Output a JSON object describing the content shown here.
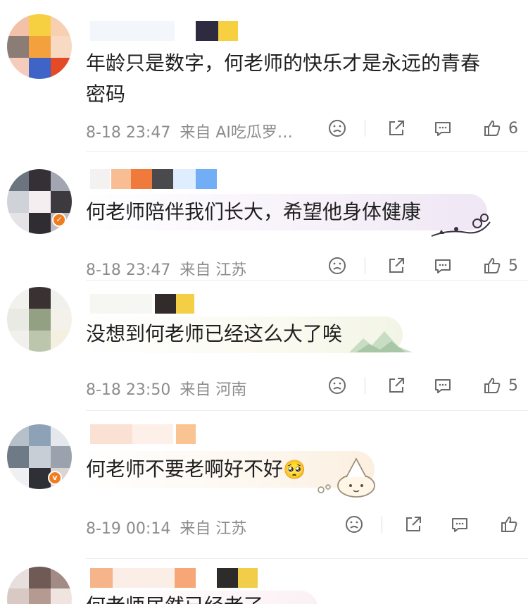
{
  "comments": [
    {
      "text_line1": "年龄只是数字，何老师的快乐才是永远的青春",
      "text_line2": "密码",
      "timestamp": "8-18 23:47",
      "source": "来自 AI吃瓜罗…",
      "likes": "6",
      "icons": [
        "dislike-icon",
        "share-icon",
        "reply-icon",
        "like-icon"
      ]
    },
    {
      "text": "何老师陪伴我们长大，希望他身体健康",
      "timestamp": "8-18 23:47",
      "source": "来自 江苏",
      "likes": "5"
    },
    {
      "text": "没想到何老师已经这么大了唉",
      "timestamp": "8-18 23:50",
      "source": "来自 河南",
      "likes": "5"
    },
    {
      "text": "何老师不要老啊好不好",
      "emoji": "🥺",
      "timestamp": "8-19 00:14",
      "source": "来自 江苏",
      "likes": ""
    },
    {
      "text": "何老师居然已经老了"
    }
  ],
  "colors": {
    "meta_gray": "#8c8c8c",
    "icon_gray": "#6a6a6a",
    "badge_orange": "#f07c20"
  }
}
